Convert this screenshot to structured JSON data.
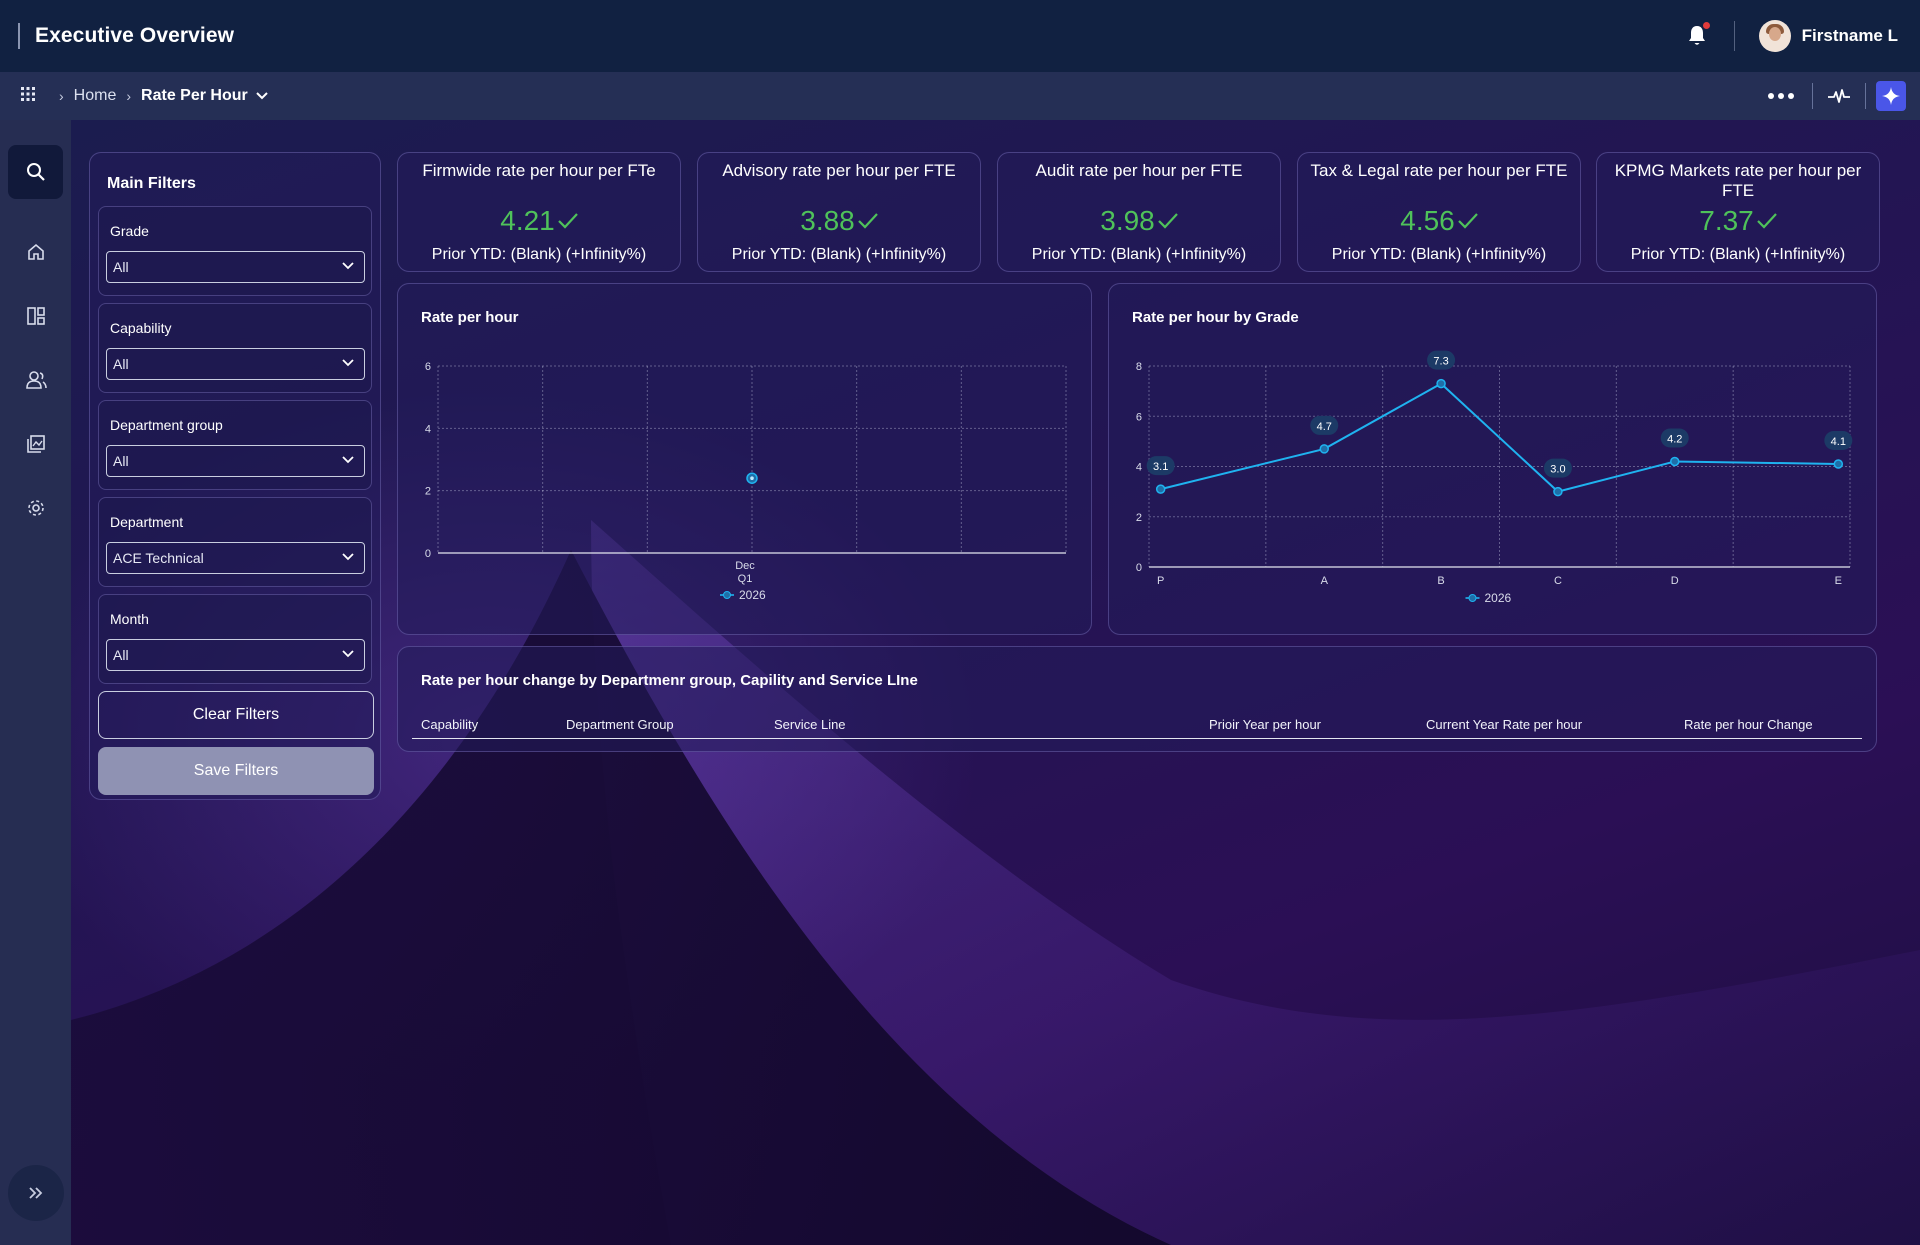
{
  "header": {
    "title": "Executive Overview",
    "user_name": "Firstname L"
  },
  "breadcrumb": {
    "home": "Home",
    "current": "Rate Per Hour"
  },
  "filters": {
    "title": "Main Filters",
    "groups": [
      {
        "label": "Grade",
        "value": "All"
      },
      {
        "label": "Capability",
        "value": "All"
      },
      {
        "label": "Department group",
        "value": "All"
      },
      {
        "label": "Department",
        "value": "ACE Technical"
      },
      {
        "label": "Month",
        "value": "All"
      }
    ],
    "clear_label": "Clear Filters",
    "save_label": "Save Filters"
  },
  "kpis": [
    {
      "title": "Firmwide rate per hour per FTe",
      "value": "4.21",
      "sub": "Prior YTD: (Blank) (+Infinity%)"
    },
    {
      "title": "Advisory rate per hour per FTE",
      "value": "3.88",
      "sub": "Prior YTD: (Blank) (+Infinity%)"
    },
    {
      "title": "Audit rate per hour per FTE",
      "value": "3.98",
      "sub": "Prior YTD: (Blank) (+Infinity%)"
    },
    {
      "title": "Tax & Legal rate per hour per FTE",
      "value": "4.56",
      "sub": "Prior YTD: (Blank) (+Infinity%)"
    },
    {
      "title": "KPMG Markets rate per hour per FTE",
      "value": "7.37",
      "sub": "Prior YTD: (Blank) (+Infinity%)"
    }
  ],
  "kpi_value_color": "#4fc25a",
  "chart_data": [
    {
      "type": "scatter",
      "title": "Rate per hour",
      "x_ticks": [
        "Dec",
        "Q1"
      ],
      "y_ticks": [
        "0",
        "2",
        "4",
        "6"
      ],
      "ylim": [
        0,
        6
      ],
      "series": [
        {
          "name": "2026",
          "x": [
            "Dec Q1"
          ],
          "values": [
            2.4
          ]
        }
      ],
      "grid": true,
      "legend": "bottom-center"
    },
    {
      "type": "line",
      "title": "Rate per hour by Grade",
      "categories": [
        "P",
        "A",
        "B",
        "C",
        "D",
        "E"
      ],
      "y_ticks": [
        "0",
        "2",
        "4",
        "6",
        "8"
      ],
      "ylim": [
        0,
        8
      ],
      "series": [
        {
          "name": "2026",
          "values": [
            3.1,
            4.7,
            7.3,
            3.0,
            4.2,
            4.1
          ]
        }
      ],
      "data_labels": [
        "3.1",
        "4.7",
        "7.3",
        "3.0",
        "4.2",
        "4.1"
      ],
      "grid": true,
      "legend": "bottom-center",
      "line_color": "#1fb3f0"
    }
  ],
  "table": {
    "title": "Rate per hour change by Departmenr group, Capility and Service LIne",
    "columns": [
      "Capability",
      "Department Group",
      "Service Line",
      "Prioir Year per hour",
      "Current Year Rate per hour",
      "Rate per hour Change"
    ]
  }
}
